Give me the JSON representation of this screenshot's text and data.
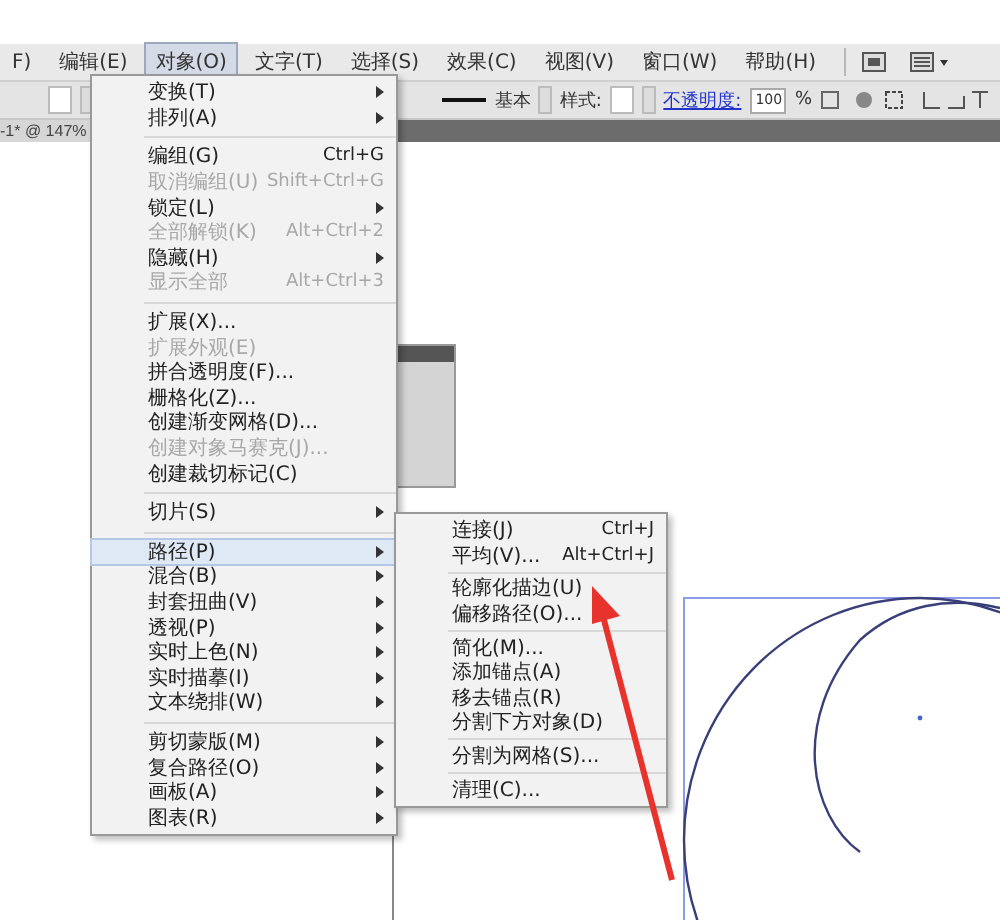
{
  "menubar": [
    {
      "label": "F)",
      "selected": false
    },
    {
      "label": "编辑(E)",
      "selected": false
    },
    {
      "label": "对象(O)",
      "selected": true
    },
    {
      "label": "文字(T)",
      "selected": false
    },
    {
      "label": "选择(S)",
      "selected": false
    },
    {
      "label": "效果(C)",
      "selected": false
    },
    {
      "label": "视图(V)",
      "selected": false
    },
    {
      "label": "窗口(W)",
      "selected": false
    },
    {
      "label": "帮助(H)",
      "selected": false
    }
  ],
  "control_bar": {
    "stroke_style": "基本",
    "style_label": "样式:",
    "opacity_label": "不透明度:",
    "opacity_value": "100",
    "percent": "%"
  },
  "document_tab": {
    "title": "-1* @ 147%"
  },
  "object_menu": [
    {
      "kind": "item",
      "label": "变换(T)",
      "submenu": true,
      "disabled": false,
      "selected": false
    },
    {
      "kind": "item",
      "label": "排列(A)",
      "submenu": true,
      "disabled": false,
      "selected": false
    },
    {
      "kind": "separator"
    },
    {
      "kind": "item",
      "label": "编组(G)",
      "shortcut": "Ctrl+G",
      "disabled": false,
      "selected": false
    },
    {
      "kind": "item",
      "label": "取消编组(U)",
      "shortcut": "Shift+Ctrl+G",
      "disabled": true,
      "selected": false
    },
    {
      "kind": "item",
      "label": "锁定(L)",
      "submenu": true,
      "disabled": false,
      "selected": false
    },
    {
      "kind": "item",
      "label": "全部解锁(K)",
      "shortcut": "Alt+Ctrl+2",
      "disabled": true,
      "selected": false
    },
    {
      "kind": "item",
      "label": "隐藏(H)",
      "submenu": true,
      "disabled": false,
      "selected": false
    },
    {
      "kind": "item",
      "label": "显示全部",
      "shortcut": "Alt+Ctrl+3",
      "disabled": true,
      "selected": false
    },
    {
      "kind": "separator"
    },
    {
      "kind": "item",
      "label": "扩展(X)...",
      "disabled": false,
      "selected": false
    },
    {
      "kind": "item",
      "label": "扩展外观(E)",
      "disabled": true,
      "selected": false
    },
    {
      "kind": "item",
      "label": "拼合透明度(F)...",
      "disabled": false,
      "selected": false
    },
    {
      "kind": "item",
      "label": "栅格化(Z)...",
      "disabled": false,
      "selected": false
    },
    {
      "kind": "item",
      "label": "创建渐变网格(D)...",
      "disabled": false,
      "selected": false
    },
    {
      "kind": "item",
      "label": "创建对象马赛克(J)...",
      "disabled": true,
      "selected": false
    },
    {
      "kind": "item",
      "label": "创建裁切标记(C)",
      "disabled": false,
      "selected": false
    },
    {
      "kind": "separator"
    },
    {
      "kind": "item",
      "label": "切片(S)",
      "submenu": true,
      "disabled": false,
      "selected": false
    },
    {
      "kind": "separator"
    },
    {
      "kind": "item",
      "label": "路径(P)",
      "submenu": true,
      "disabled": false,
      "selected": true
    },
    {
      "kind": "item",
      "label": "混合(B)",
      "submenu": true,
      "disabled": false,
      "selected": false
    },
    {
      "kind": "item",
      "label": "封套扭曲(V)",
      "submenu": true,
      "disabled": false,
      "selected": false
    },
    {
      "kind": "item",
      "label": "透视(P)",
      "submenu": true,
      "disabled": false,
      "selected": false
    },
    {
      "kind": "item",
      "label": "实时上色(N)",
      "submenu": true,
      "disabled": false,
      "selected": false
    },
    {
      "kind": "item",
      "label": "实时描摹(I)",
      "submenu": true,
      "disabled": false,
      "selected": false
    },
    {
      "kind": "item",
      "label": "文本绕排(W)",
      "submenu": true,
      "disabled": false,
      "selected": false
    },
    {
      "kind": "separator"
    },
    {
      "kind": "item",
      "label": "剪切蒙版(M)",
      "submenu": true,
      "disabled": false,
      "selected": false
    },
    {
      "kind": "item",
      "label": "复合路径(O)",
      "submenu": true,
      "disabled": false,
      "selected": false
    },
    {
      "kind": "item",
      "label": "画板(A)",
      "submenu": true,
      "disabled": false,
      "selected": false
    },
    {
      "kind": "item",
      "label": "图表(R)",
      "submenu": true,
      "disabled": false,
      "selected": false
    }
  ],
  "path_submenu": [
    {
      "kind": "item",
      "label": "连接(J)",
      "shortcut": "Ctrl+J"
    },
    {
      "kind": "item",
      "label": "平均(V)...",
      "shortcut": "Alt+Ctrl+J"
    },
    {
      "kind": "separator"
    },
    {
      "kind": "item",
      "label": "轮廓化描边(U)"
    },
    {
      "kind": "item",
      "label": "偏移路径(O)..."
    },
    {
      "kind": "separator"
    },
    {
      "kind": "item",
      "label": "简化(M)..."
    },
    {
      "kind": "item",
      "label": "添加锚点(A)"
    },
    {
      "kind": "item",
      "label": "移去锚点(R)"
    },
    {
      "kind": "item",
      "label": "分割下方对象(D)"
    },
    {
      "kind": "separator"
    },
    {
      "kind": "item",
      "label": "分割为网格(S)..."
    },
    {
      "kind": "separator"
    },
    {
      "kind": "item",
      "label": "清理(C)..."
    }
  ]
}
